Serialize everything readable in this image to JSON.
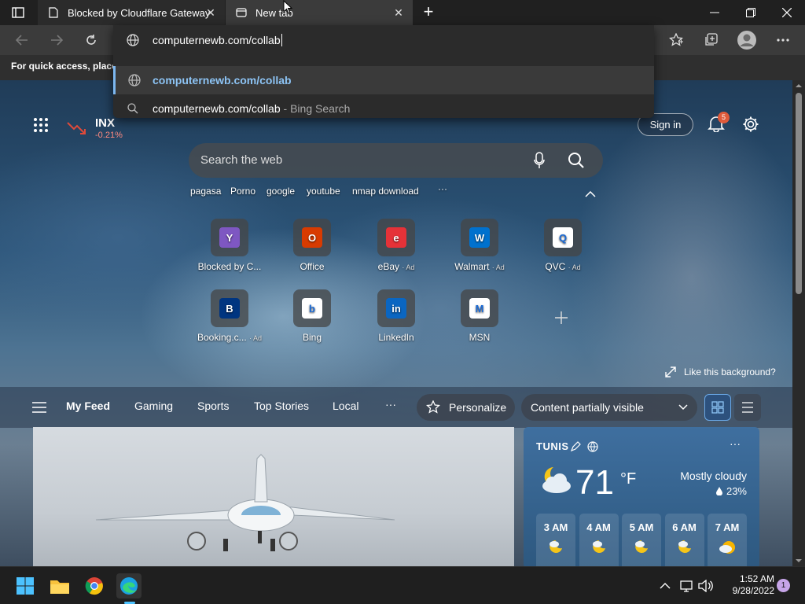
{
  "tabs": [
    {
      "title": "Blocked by Cloudflare Gateway",
      "icon": "page-icon"
    },
    {
      "title": "New tab",
      "icon": "newtab-icon"
    }
  ],
  "address": {
    "value": "computernewb.com/collab"
  },
  "suggestions": [
    {
      "text": "computernewb.com/collab",
      "suffix": ""
    },
    {
      "text": "computernewb.com/collab",
      "suffix": " - Bing Search"
    }
  ],
  "favorites_bar_text": "For quick access, place y",
  "page": {
    "stock": {
      "symbol": "INX",
      "change": "-0.21%"
    },
    "sign_in": "Sign in",
    "notif_count": "5",
    "search_placeholder": "Search the web",
    "quick_links": [
      "pagasa",
      "Porno",
      "google",
      "youtube",
      "nmap download",
      "···"
    ],
    "shortcuts": [
      {
        "label": "Blocked by C...",
        "ad": "",
        "color": "#7e57c2",
        "glyph": "Y"
      },
      {
        "label": "Office",
        "ad": "",
        "color": "#d83b01",
        "glyph": "O"
      },
      {
        "label": "eBay",
        "ad": "· Ad",
        "color": "#e53238",
        "glyph": "e"
      },
      {
        "label": "Walmart",
        "ad": "· Ad",
        "color": "#0071ce",
        "glyph": "W"
      },
      {
        "label": "QVC",
        "ad": "· Ad",
        "color": "#ffffff",
        "glyph": "Q"
      },
      {
        "label": "Booking.c...",
        "ad": "· Ad",
        "color": "#003580",
        "glyph": "B"
      },
      {
        "label": "Bing",
        "ad": "",
        "color": "#ffffff",
        "glyph": "b"
      },
      {
        "label": "LinkedIn",
        "ad": "",
        "color": "#0a66c2",
        "glyph": "in"
      },
      {
        "label": "MSN",
        "ad": "",
        "color": "#ffffff",
        "glyph": "M"
      }
    ],
    "like_bg": "Like this background?",
    "feed_nav": {
      "my_feed": "My Feed",
      "gaming": "Gaming",
      "sports": "Sports",
      "top_stories": "Top Stories",
      "local": "Local",
      "more": "···",
      "personalize": "Personalize",
      "content": "Content partially visible"
    },
    "weather": {
      "city": "TUNIS",
      "temp": "71",
      "unit": "°F",
      "condition": "Mostly cloudy",
      "precip": "23%",
      "more": "···",
      "hours": [
        "3 AM",
        "4 AM",
        "5 AM",
        "6 AM",
        "7 AM"
      ]
    }
  },
  "taskbar": {
    "time": "1:52 AM",
    "date": "9/28/2022",
    "notif": "1"
  }
}
